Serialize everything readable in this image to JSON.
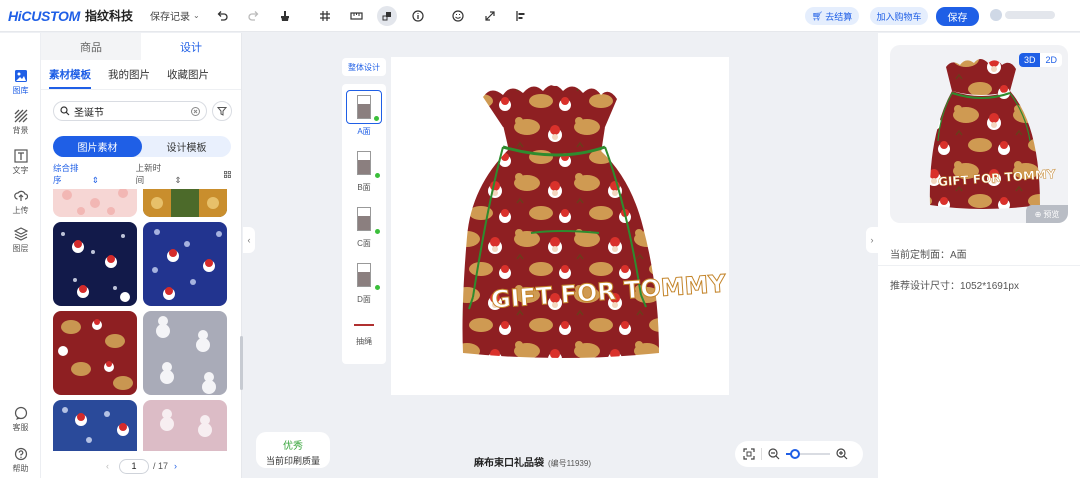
{
  "header": {
    "brand": "HiCUSTOM",
    "brand_cn": "指纹科技",
    "save_record": "保存记录",
    "checkout": "去结算",
    "add_to_cart": "加入购物车",
    "save": "保存",
    "icons": [
      "undo-icon",
      "redo-icon",
      "brush-icon",
      "grid-icon",
      "ruler-icon",
      "layers-tool-icon",
      "info-icon",
      "smile-icon",
      "expand-icon",
      "align-icon"
    ]
  },
  "rail": {
    "items": [
      {
        "label": "图库",
        "icon": "gallery-icon"
      },
      {
        "label": "背景",
        "icon": "background-icon"
      },
      {
        "label": "文字",
        "icon": "text-icon"
      },
      {
        "label": "上传",
        "icon": "upload-icon"
      },
      {
        "label": "图层",
        "icon": "layers-icon"
      }
    ],
    "bottom": [
      {
        "label": "客服",
        "icon": "support-icon"
      },
      {
        "label": "帮助",
        "icon": "help-icon"
      }
    ]
  },
  "library": {
    "tabs": [
      "商品",
      "设计"
    ],
    "active_tab": "设计",
    "subtabs": [
      "素材模板",
      "我的图片",
      "收藏图片"
    ],
    "search_value": "圣诞节",
    "segments": [
      "图片素材",
      "设计模板"
    ],
    "sort": [
      "综合排序",
      "上新时间"
    ],
    "page": {
      "current": "1",
      "total": "/ 17"
    }
  },
  "views": {
    "header": "整体设计",
    "items": [
      "A面",
      "B面",
      "C面",
      "D面"
    ],
    "cord": "抽绳"
  },
  "canvas": {
    "quality_level": "优秀",
    "quality_label": "当前印刷质量",
    "product_name": "麻布束口礼品袋",
    "product_code": "(编号11939)",
    "print_text": "GIFT FOR TOMMY",
    "zoom_fraction": 0.2
  },
  "right": {
    "mode_3d": "3D",
    "mode_2d": "2D",
    "preview_button": "预览",
    "current_face": "当前定制面：A面",
    "recommended_size": "推荐设计尺寸：1052*1691px"
  },
  "colors": {
    "accent": "#1f5fe6",
    "bag": "#8e1f22",
    "cord": "#2e8b2e",
    "good": "#38a53c"
  }
}
